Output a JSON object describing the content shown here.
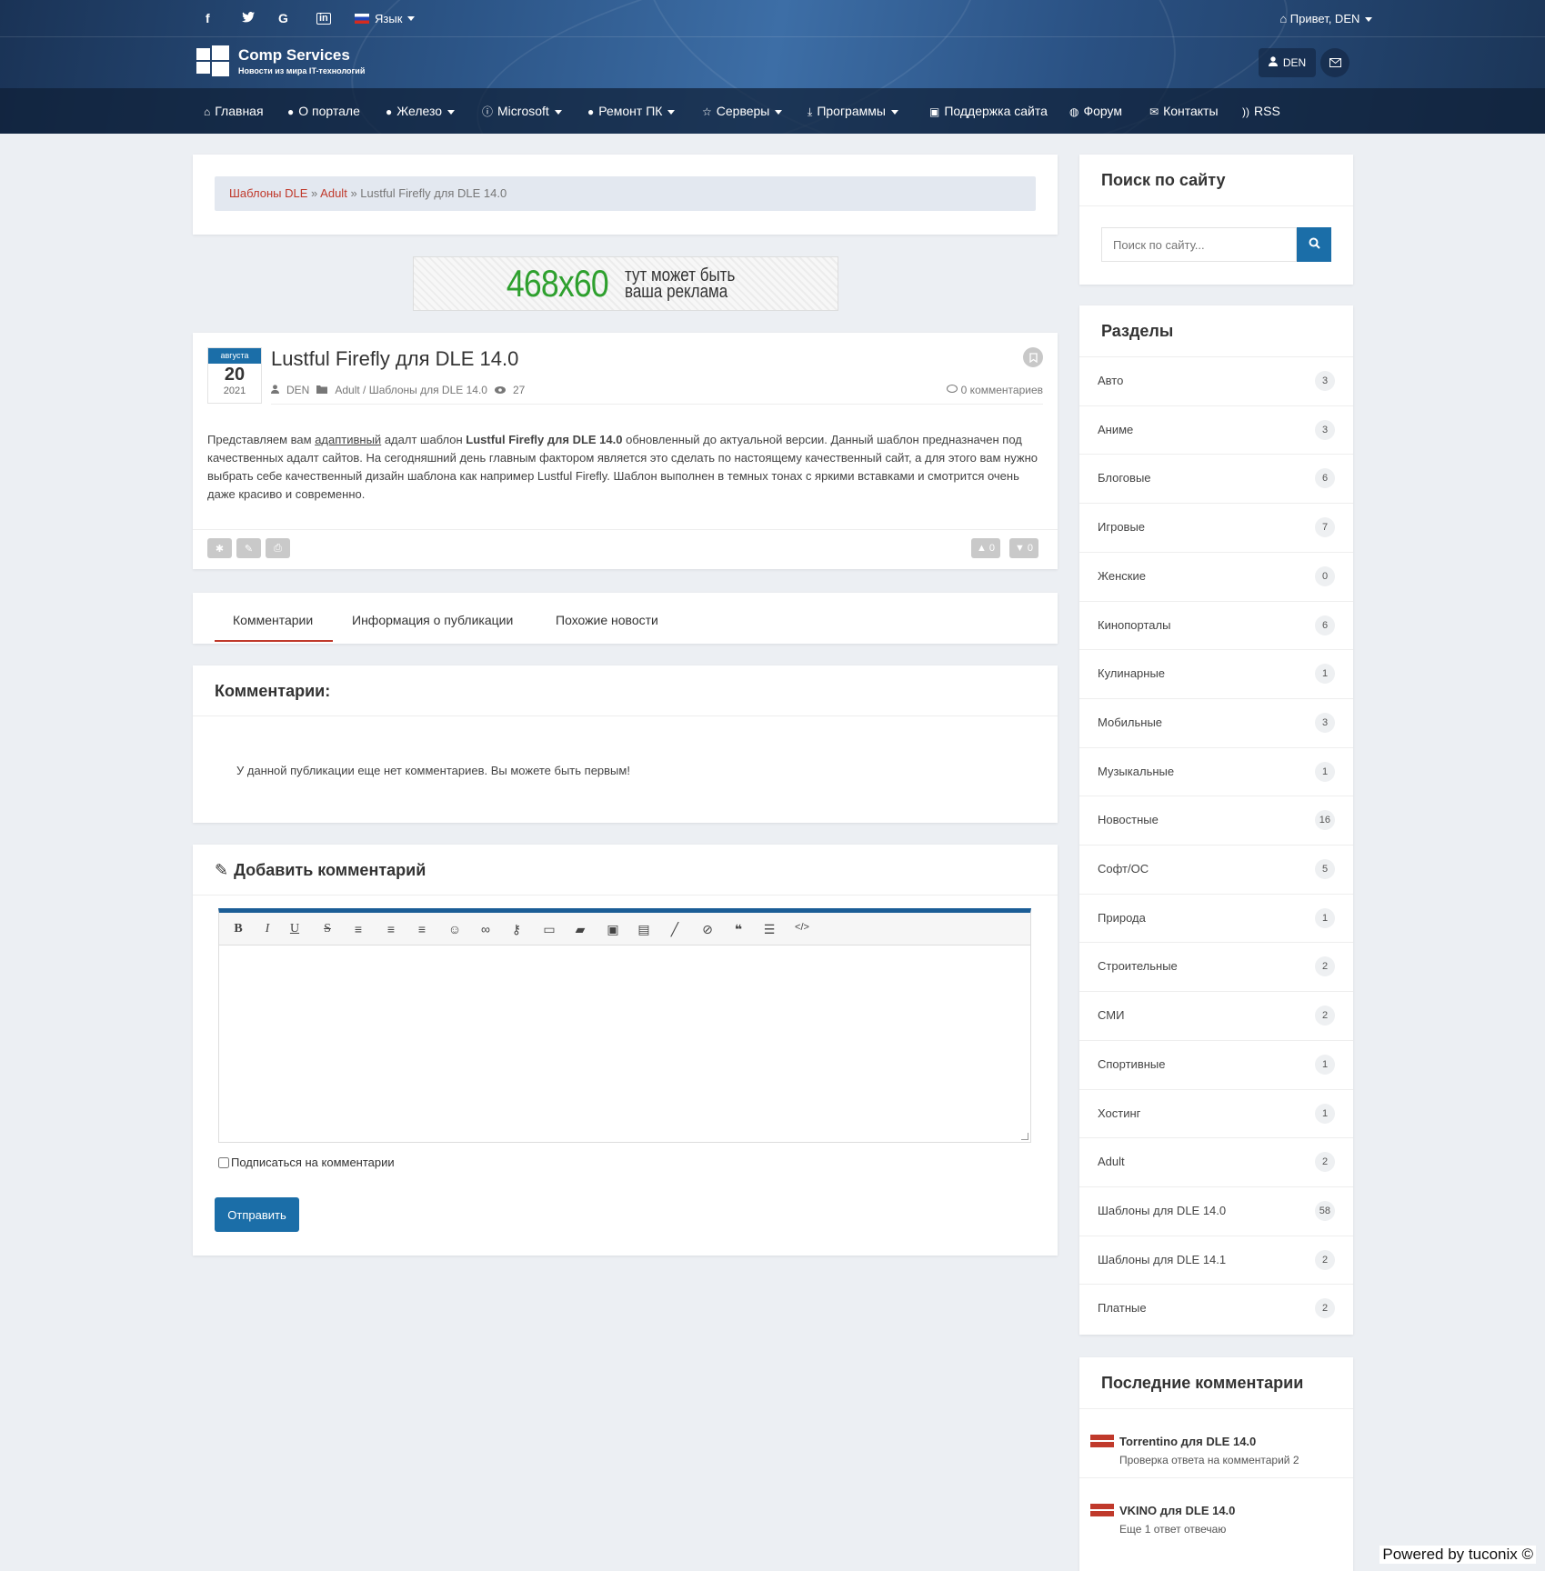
{
  "topbar": {
    "socials": [
      "f",
      "t",
      "G",
      "in"
    ],
    "language_label": "Язык",
    "greeting": "Привет, DEN"
  },
  "brand": {
    "title": "Comp Services",
    "subtitle": "Новости из мира IT-технологий"
  },
  "user": {
    "name": "DEN"
  },
  "nav": [
    {
      "label": "Главная",
      "icon": "home-icon",
      "dropdown": false
    },
    {
      "label": "О портале",
      "icon": "globe-icon",
      "dropdown": false
    },
    {
      "label": "Железо",
      "icon": "globe-icon",
      "dropdown": true
    },
    {
      "label": "Microsoft",
      "icon": "info-icon",
      "dropdown": true
    },
    {
      "label": "Ремонт ПК",
      "icon": "globe-icon",
      "dropdown": true
    },
    {
      "label": "Серверы",
      "icon": "star-icon",
      "dropdown": true
    },
    {
      "label": "Программы",
      "icon": "download-icon",
      "dropdown": true
    },
    {
      "label": "Поддержка сайта",
      "icon": "money-icon",
      "dropdown": false
    },
    {
      "label": "Форум",
      "icon": "comments-icon",
      "dropdown": false
    },
    {
      "label": "Контакты",
      "icon": "envelope-icon",
      "dropdown": false
    },
    {
      "label": "RSS",
      "icon": "rss-icon",
      "dropdown": false
    }
  ],
  "breadcrumb": {
    "part1": "Шаблоны DLE",
    "sep": "»",
    "part2": "Adult",
    "current": "Lustful Firefly для DLE 14.0"
  },
  "ad_banner": {
    "size": "468x60",
    "line1": "тут может быть",
    "line2": "ваша реклама"
  },
  "post": {
    "date_month": "августа",
    "date_day": "20",
    "date_year": "2021",
    "title": "Lustful Firefly для DLE 14.0",
    "author": "DEN",
    "categories": "Adult / Шаблоны для DLE 14.0",
    "views": "27",
    "comments": "0 комментариев",
    "text_before_link": "Представляем вам ",
    "text_link": "адаптивный",
    "text_mid": " адалт шаблон ",
    "text_bold": "Lustful Firefly для DLE 14.0",
    "text_after": " обновленный до актуальной версии. Данный шаблон предназначен под качественных адалт сайтов. На сегодняшний день главным фактором является это сделать по настоящему качественный сайт, а для этого вам нужно выбрать себе качественный дизайн шаблона как например Lustful Firefly. Шаблон выполнен в темных тонах с яркими вставками и смотрится очень даже красиво и современно.",
    "votes_up": "0",
    "votes_down": "0"
  },
  "tabs": [
    "Комментарии",
    "Информация о публикации",
    "Похожие новости"
  ],
  "comments_block": {
    "title": "Комментарии:",
    "empty_text": "У данной публикации еще нет комментариев. Вы можете быть первым!"
  },
  "add_comment": {
    "title": "Добавить комментарий",
    "tools": [
      "bold-icon",
      "italic-icon",
      "underline-icon",
      "strike-icon",
      "align-left-icon",
      "align-center-icon",
      "align-right-icon",
      "smile-icon",
      "link-icon",
      "unlink-icon",
      "image-icon",
      "folder-icon",
      "media-icon",
      "spoiler-icon",
      "color-icon",
      "hide-icon",
      "quote-icon",
      "list-icon",
      "code-icon"
    ],
    "subscribe_label": "Подписаться на комментарии",
    "submit_label": "Отправить"
  },
  "sidebar": {
    "search": {
      "title": "Поиск по сайту",
      "placeholder": "Поиск по сайту..."
    },
    "sections": {
      "title": "Разделы",
      "items": [
        {
          "label": "Авто",
          "count": "3"
        },
        {
          "label": "Аниме",
          "count": "3"
        },
        {
          "label": "Блоговые",
          "count": "6"
        },
        {
          "label": "Игровые",
          "count": "7"
        },
        {
          "label": "Женские",
          "count": "0"
        },
        {
          "label": "Кинопорталы",
          "count": "6"
        },
        {
          "label": "Кулинарные",
          "count": "1"
        },
        {
          "label": "Мобильные",
          "count": "3"
        },
        {
          "label": "Музыкальные",
          "count": "1"
        },
        {
          "label": "Новостные",
          "count": "16"
        },
        {
          "label": "Софт/ОС",
          "count": "5"
        },
        {
          "label": "Природа",
          "count": "1"
        },
        {
          "label": "Строительные",
          "count": "2"
        },
        {
          "label": "СМИ",
          "count": "2"
        },
        {
          "label": "Спортивные",
          "count": "1"
        },
        {
          "label": "Хостинг",
          "count": "1"
        },
        {
          "label": "Adult",
          "count": "2"
        },
        {
          "label": "Шаблоны для DLE 14.0",
          "count": "58"
        },
        {
          "label": "Шаблоны для DLE 14.1",
          "count": "2"
        },
        {
          "label": "Платные",
          "count": "2"
        }
      ]
    },
    "last_comments": {
      "title": "Последние комментарии",
      "items": [
        {
          "title": "Torrentino для DLE 14.0",
          "text": "Проверка ответа на комментарий 2"
        },
        {
          "title": "VKINO для DLE 14.0",
          "text": "Еще 1 ответ отвечаю"
        }
      ]
    }
  },
  "footer": {
    "powered": "Powered by tuconix ©"
  }
}
